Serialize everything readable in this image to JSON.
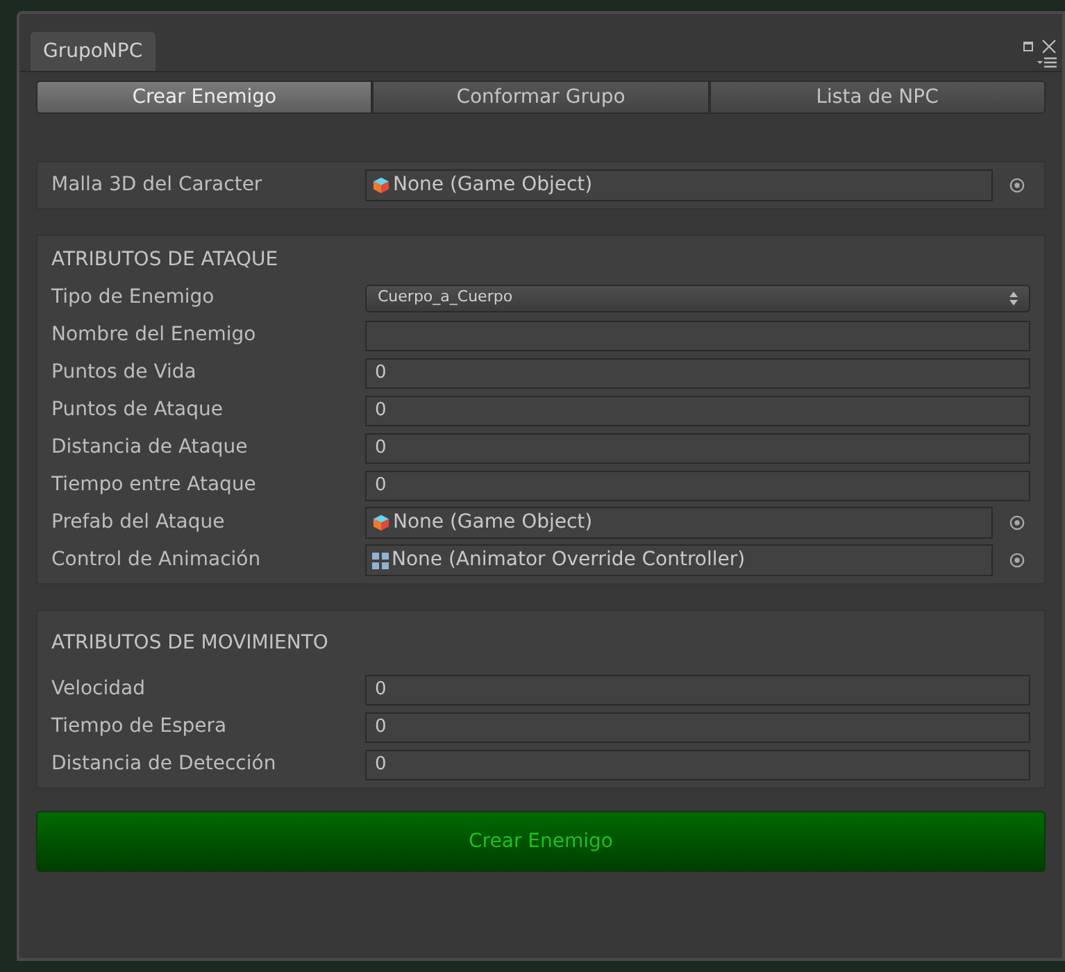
{
  "window": {
    "tab": "GrupoNPC"
  },
  "tabs": [
    {
      "label": "Crear Enemigo",
      "selected": true
    },
    {
      "label": "Conformar Grupo",
      "selected": false
    },
    {
      "label": "Lista de NPC",
      "selected": false
    }
  ],
  "sections": [
    {
      "fields": [
        {
          "kind": "gameobject",
          "label": "Malla 3D del Caracter",
          "value": "None (Game Object)"
        }
      ]
    },
    {
      "title": "ATRIBUTOS DE ATAQUE",
      "fields": [
        {
          "kind": "dropdown",
          "label": "Tipo de Enemigo",
          "value": "Cuerpo_a_Cuerpo"
        },
        {
          "kind": "text",
          "label": "Nombre del Enemigo"
        },
        {
          "kind": "text",
          "label": "Puntos de Vida",
          "value": "0"
        },
        {
          "kind": "text",
          "label": "Puntos de Ataque",
          "value": "0"
        },
        {
          "kind": "text",
          "label": "Distancia de Ataque",
          "value": "0"
        },
        {
          "kind": "text",
          "label": "Tiempo entre Ataque",
          "value": "0"
        },
        {
          "kind": "gameobject",
          "label": "Prefab del Ataque",
          "value": "None (Game Object)"
        },
        {
          "kind": "controller",
          "label": "Control de Animación",
          "value": "None (Animator Override Controller)"
        }
      ]
    },
    {
      "title": "ATRIBUTOS DE MOVIMIENTO",
      "fields": [
        {
          "kind": "text",
          "label": "Velocidad",
          "value": "0"
        },
        {
          "kind": "text",
          "label": "Tiempo de Espera",
          "value": "0"
        },
        {
          "kind": "text",
          "label": "Distancia de Detección",
          "value": "0"
        }
      ]
    }
  ],
  "action": {
    "label": "Crear Enemigo"
  }
}
